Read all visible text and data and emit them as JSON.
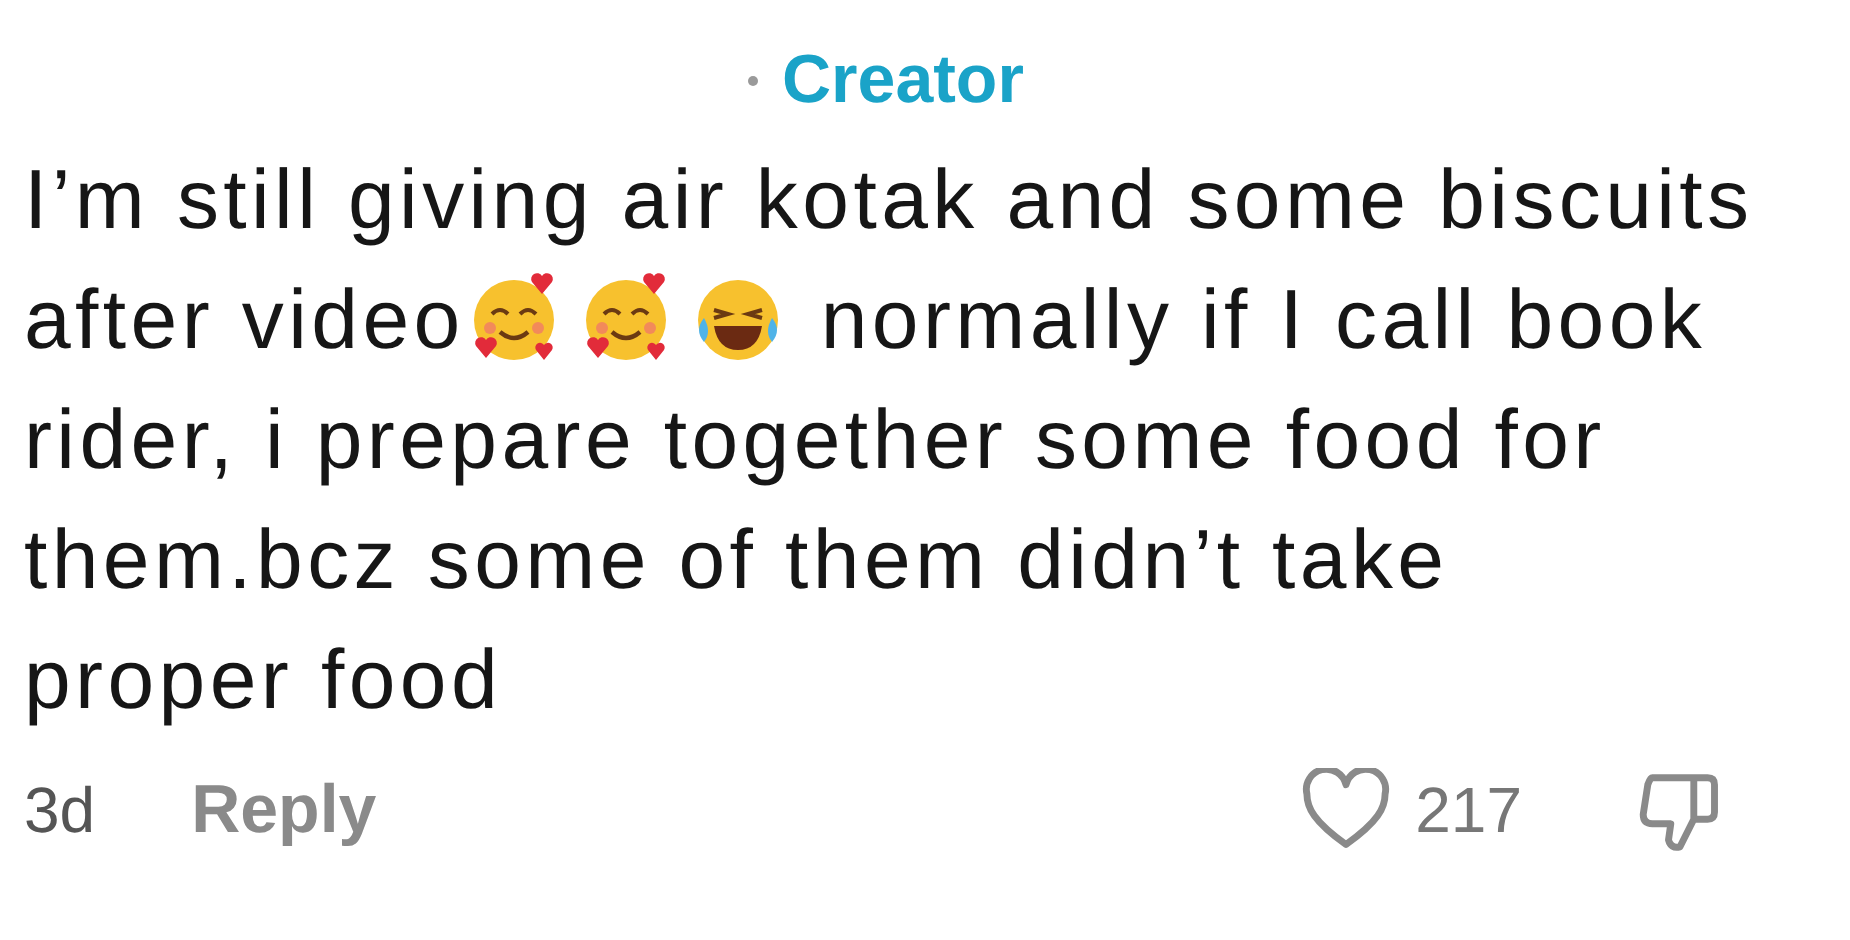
{
  "comment": {
    "badge": "Creator",
    "lines": [
      [
        {
          "kind": "text",
          "text": "I’m still giving air kotak and some biscuits"
        }
      ],
      [
        {
          "kind": "text",
          "text": "after video"
        },
        {
          "kind": "hearts-emoji"
        },
        {
          "kind": "hearts-emoji"
        },
        {
          "kind": "laugh-emoji"
        },
        {
          "kind": "text",
          "text": "normally if I call book"
        }
      ],
      [
        {
          "kind": "text",
          "text": "rider, i prepare together some food for"
        }
      ],
      [
        {
          "kind": "text",
          "text": "them.bcz some of them didn’t take"
        }
      ],
      [
        {
          "kind": "text",
          "text": "proper food"
        }
      ]
    ],
    "age": "3d",
    "reply": "Reply",
    "likes": "217"
  }
}
